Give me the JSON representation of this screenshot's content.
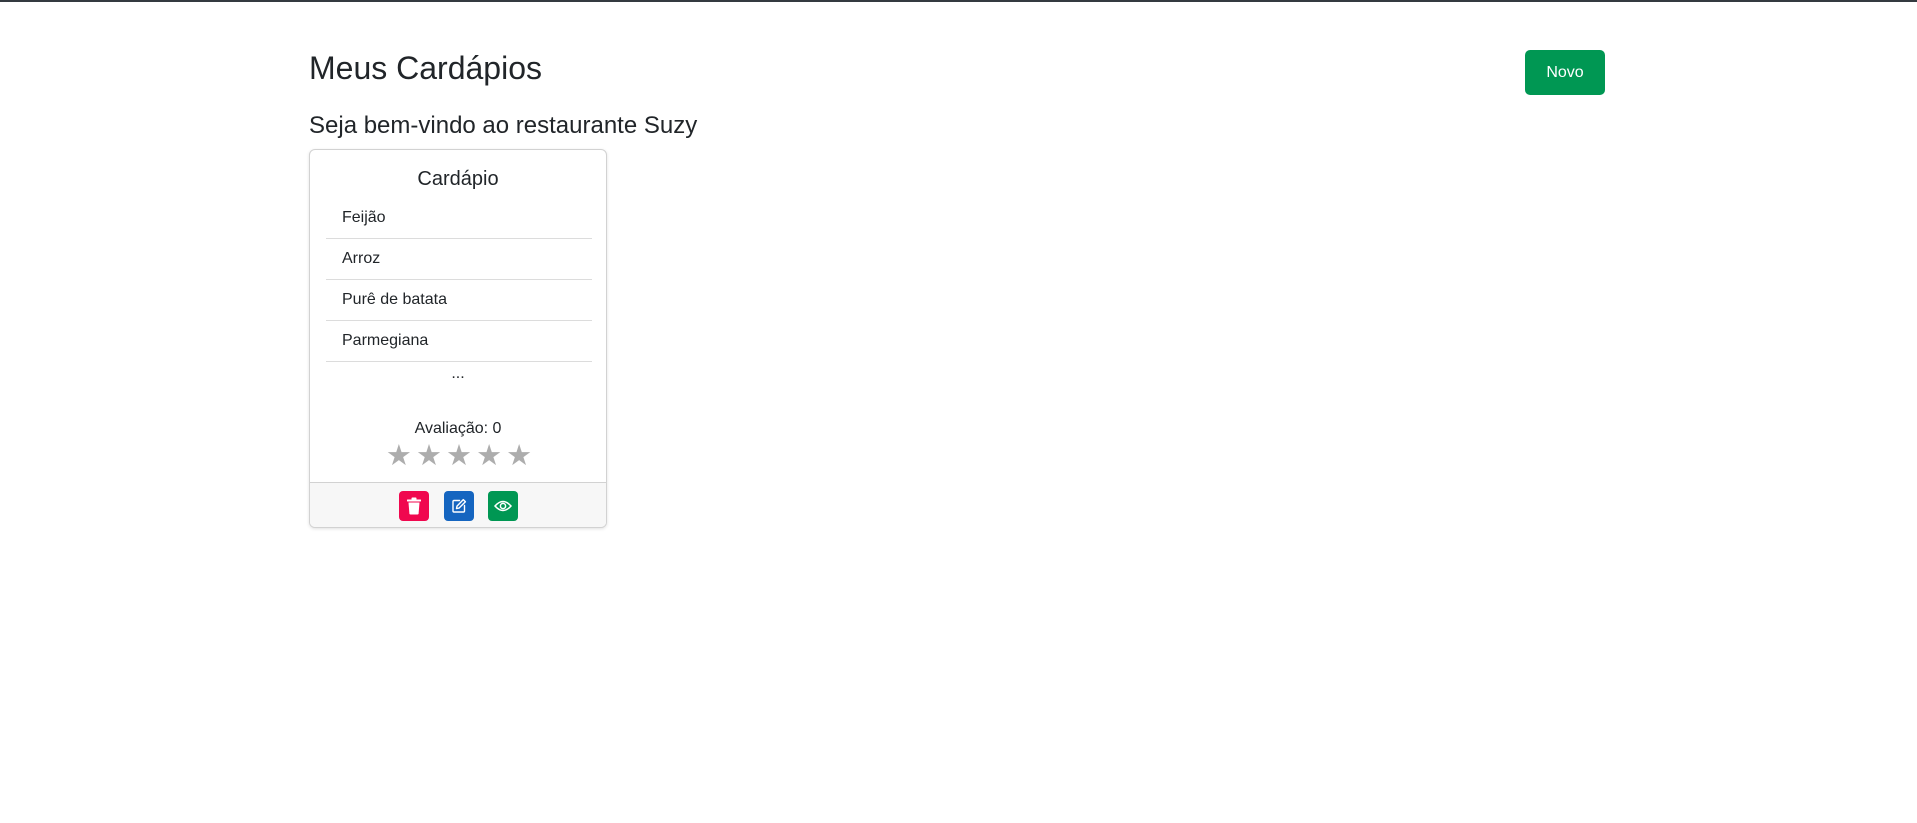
{
  "header": {
    "title": "Meus Cardápios",
    "new_button_label": "Novo"
  },
  "welcome": "Seja bem-vindo ao restaurante Suzy",
  "card": {
    "title": "Cardápio",
    "items": [
      "Feijão",
      "Arroz",
      "Purê de batata",
      "Parmegiana"
    ],
    "more": "...",
    "rating_label": "Avaliação: 0",
    "rating_value": 0,
    "rating_max": 5,
    "star_glyph": "★",
    "star_color": "#adadad",
    "actions": [
      {
        "name": "delete",
        "icon": "trash-icon",
        "color": "#f0084f"
      },
      {
        "name": "edit",
        "icon": "edit-icon",
        "color": "#1565c0"
      },
      {
        "name": "view",
        "icon": "eye-icon",
        "color": "#009753"
      }
    ]
  },
  "colors": {
    "primary_green": "#009753",
    "text": "#212529",
    "top_border": "#343a40"
  }
}
